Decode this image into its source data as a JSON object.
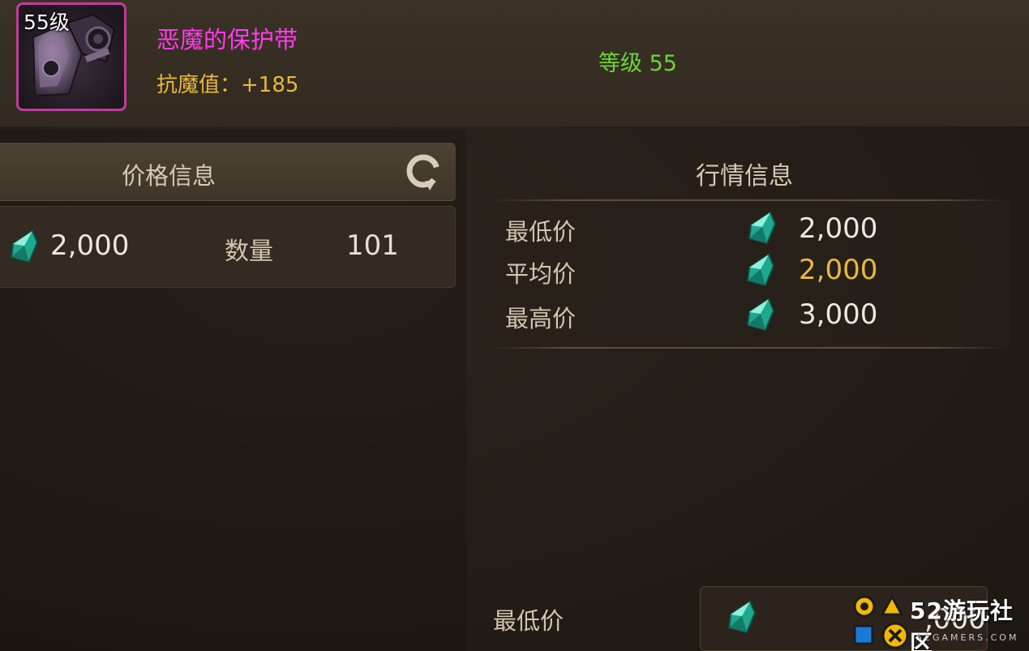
{
  "item": {
    "level_badge": "55级",
    "name": "恶魔的保护带",
    "stat": "抗魔值：+185",
    "requirement": "等级 55",
    "icon": "demon-belt-icon",
    "rarity_color": "#c33a9c"
  },
  "price_info": {
    "title": "价格信息",
    "refresh_icon": "refresh-icon",
    "currency_icon": "gem-icon",
    "price": "2,000",
    "quantity_label": "数量",
    "quantity": "101"
  },
  "market_info": {
    "title": "行情信息",
    "rows": [
      {
        "label": "最低价",
        "value": "2,000"
      },
      {
        "label": "平均价",
        "value": "2,000"
      },
      {
        "label": "最高价",
        "value": "3,000"
      }
    ]
  },
  "bottom": {
    "label": "最低价",
    "value": ",000"
  },
  "watermark": {
    "text": "52游玩社区",
    "sub": "52GAMERS.COM"
  },
  "colors": {
    "item_name": "#ff3ce9",
    "stat": "#e9b93a",
    "requirement": "#6bd43a",
    "average_price": "#e9b93a"
  }
}
